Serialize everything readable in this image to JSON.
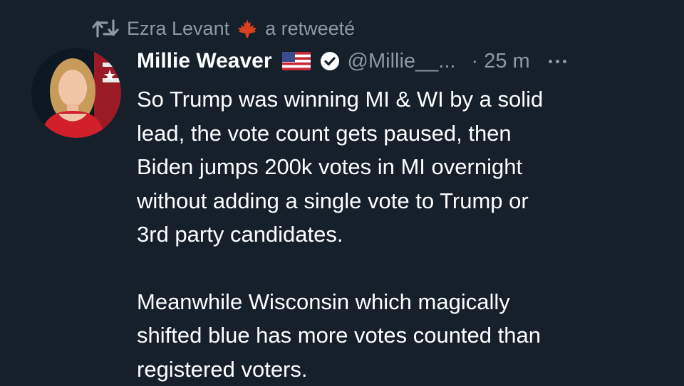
{
  "retweet": {
    "icon": "retweet-icon",
    "user": "Ezra Levant",
    "badge_icon": "maple-leaf-icon",
    "action": "a retweeté"
  },
  "tweet": {
    "author": {
      "name": "Millie Weaver",
      "flag_icon": "us-flag-icon",
      "verified_icon": "verified-badge-icon",
      "handle": "@Millie__...",
      "avatar_icon": "profile-avatar"
    },
    "time": "· 25 m",
    "more_icon": "more-options-icon",
    "paragraphs": [
      {
        "lines": [
          "So Trump was winning MI & WI by a solid",
          "lead, the vote count gets paused, then",
          "Biden jumps 200k votes in MI overnight",
          "without adding a single vote to Trump or",
          "3rd party candidates."
        ]
      },
      {
        "lines": [
          "Meanwhile Wisconsin which magically",
          "shifted blue has more votes counted than",
          "registered voters."
        ]
      }
    ]
  },
  "colors": {
    "background": "#15202b",
    "text": "#ffffff",
    "secondary_text": "#8b98a5",
    "maple_leaf": "#d8401e"
  }
}
